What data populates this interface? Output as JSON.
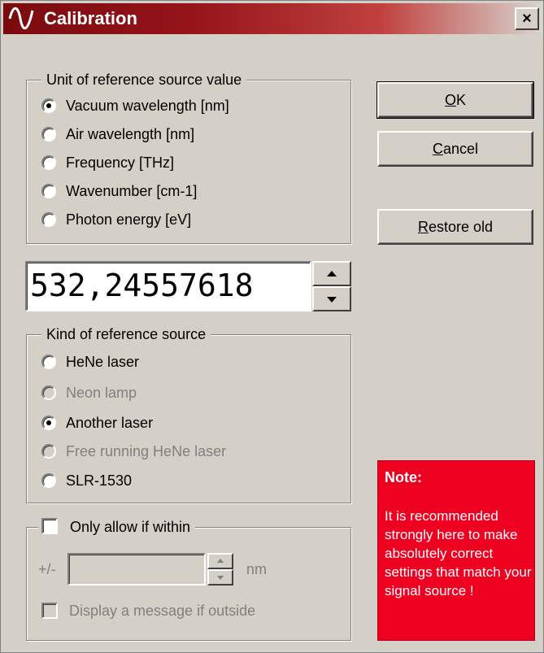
{
  "window": {
    "title": "Calibration",
    "close_label": "×"
  },
  "unit_group": {
    "legend": "Unit of reference source value",
    "options": [
      {
        "label": "Vacuum wavelength  [nm]",
        "selected": true
      },
      {
        "label": "Air wavelength  [nm]",
        "selected": false
      },
      {
        "label": "Frequency  [THz]",
        "selected": false
      },
      {
        "label": "Wavenumber  [cm-1]",
        "selected": false
      },
      {
        "label": "Photon energy  [eV]",
        "selected": false
      }
    ]
  },
  "value_field": {
    "value": "532,24557618"
  },
  "source_group": {
    "legend": "Kind of reference source",
    "options": [
      {
        "label": "HeNe laser",
        "selected": false,
        "disabled": false
      },
      {
        "label": "Neon lamp",
        "selected": false,
        "disabled": true
      },
      {
        "label": "Another laser",
        "selected": true,
        "disabled": false
      },
      {
        "label": "Free running HeNe laser",
        "selected": false,
        "disabled": true
      },
      {
        "label": "SLR-1530",
        "selected": false,
        "disabled": false
      }
    ]
  },
  "limit_group": {
    "checkbox_label": "Only allow if within",
    "checked": false,
    "prefix": "+/-",
    "value": "",
    "unit": "nm",
    "message_label": "Display a message if outside",
    "message_checked": false
  },
  "buttons": {
    "ok_mnemonic": "O",
    "ok_rest": "K",
    "cancel_mnemonic": "C",
    "cancel_rest": "ancel",
    "restore_mnemonic": "R",
    "restore_rest": "estore old"
  },
  "note": {
    "title": "Note:",
    "body": "It is recommended strongly here to make absolutely correct settings that match your signal source !"
  },
  "colors": {
    "titlebar_start": "#7a0a0e",
    "note_background": "#ee0020",
    "dialog_background": "#d4d0c8"
  }
}
